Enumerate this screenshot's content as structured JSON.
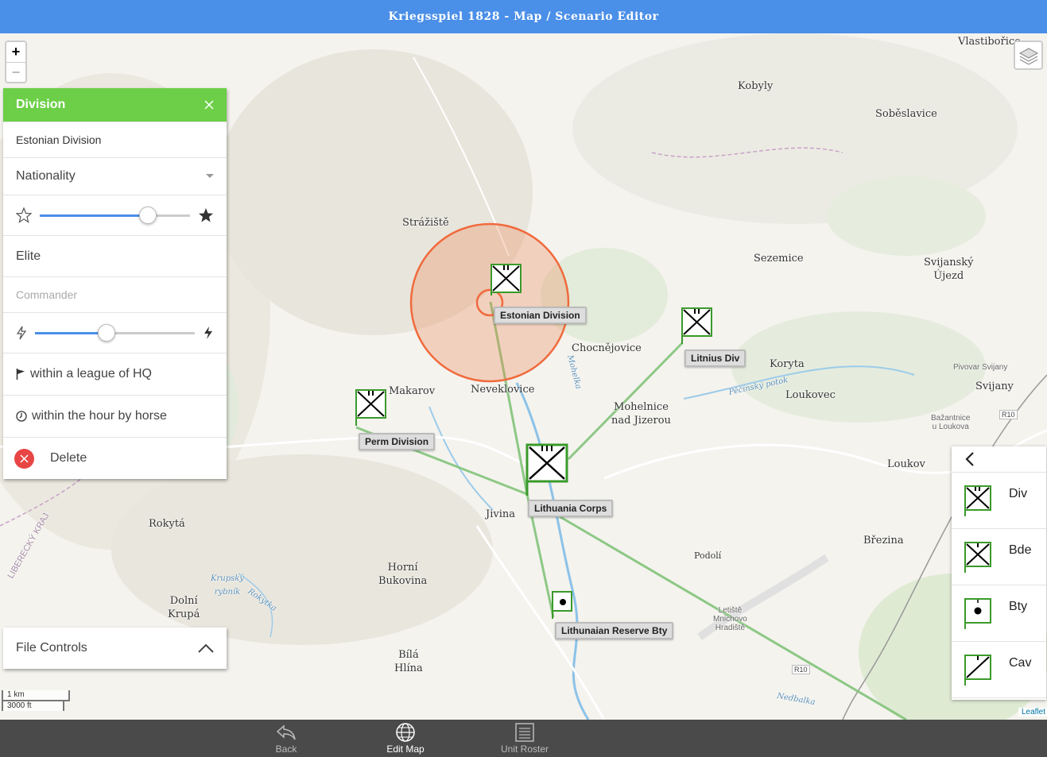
{
  "title": "Kriegsspiel 1828 - Map / Scenario Editor",
  "map": {
    "zoom_in": "+",
    "zoom_out": "−",
    "places": [
      {
        "name": "Vlastibořice"
      },
      {
        "name": "Kobyly"
      },
      {
        "name": "Soběslavice"
      },
      {
        "name": "Strážiště"
      },
      {
        "name": "Sezemice"
      },
      {
        "name": "Svijanský\nÚjezd"
      },
      {
        "name": "Chocnějovice"
      },
      {
        "name": "Koryta"
      },
      {
        "name": "Pivovar Svijany"
      },
      {
        "name": "Svijany"
      },
      {
        "name": "Makarov"
      },
      {
        "name": "Neveklovice"
      },
      {
        "name": "Loukovec"
      },
      {
        "name": "Mohelnice\nnad Jizerou"
      },
      {
        "name": "Bažantnice\nu Loukova"
      },
      {
        "name": "Loukov"
      },
      {
        "name": "Rokytá"
      },
      {
        "name": "Jivina"
      },
      {
        "name": "Březina"
      },
      {
        "name": "Podolí"
      },
      {
        "name": "Horní\nBukovina"
      },
      {
        "name": "Dolní\nKrupá"
      },
      {
        "name": "Letiště\nMnichovo\nHradiště"
      },
      {
        "name": "Bílá\nHlína"
      },
      {
        "name": "Krupský\nrybník"
      },
      {
        "name": "Rokytka"
      },
      {
        "name": "Pěčínský potok"
      },
      {
        "name": "Nedbalka"
      },
      {
        "name": "Mohelka"
      },
      {
        "name": "LIBERECKÝ KRAJ"
      }
    ],
    "road_tags": [
      "R10",
      "R10"
    ],
    "units": [
      {
        "label": "Estonian Division"
      },
      {
        "label": "Litnius Div"
      },
      {
        "label": "Perm Division"
      },
      {
        "label": "Lithuania Corps"
      },
      {
        "label": "Lithunaian Reserve Bty"
      }
    ],
    "scale_km": "1 km",
    "scale_ft": "3000 ft",
    "attribution": "Leaflet"
  },
  "panel": {
    "header": "Division",
    "name_value": "Estonian Division",
    "nationality_label": "Nationality",
    "quality_value": 0.72,
    "quality_text": "Elite",
    "commander_placeholder": "Commander",
    "speed_value": 0.45,
    "league_text": "within a league of HQ",
    "hour_text": "within the hour by horse",
    "delete_label": "Delete"
  },
  "file_controls": {
    "label": "File Controls"
  },
  "palette": {
    "items": [
      {
        "label": "Div",
        "icon": "division-symbol-icon"
      },
      {
        "label": "Bde",
        "icon": "brigade-symbol-icon"
      },
      {
        "label": "Bty",
        "icon": "battery-symbol-icon"
      },
      {
        "label": "Cav",
        "icon": "cavalry-symbol-icon"
      }
    ]
  },
  "tabs": [
    {
      "label": "Back",
      "icon": "back-arrow-icon"
    },
    {
      "label": "Edit Map",
      "icon": "globe-icon",
      "active": true
    },
    {
      "label": "Unit Roster",
      "icon": "roster-icon"
    }
  ],
  "colors": {
    "title_bar": "#4a8fe8",
    "panel_header": "#6ccf47",
    "unit_green": "#3a9a2a",
    "range_circle": "#f06a3c",
    "delete": "#e84545"
  }
}
